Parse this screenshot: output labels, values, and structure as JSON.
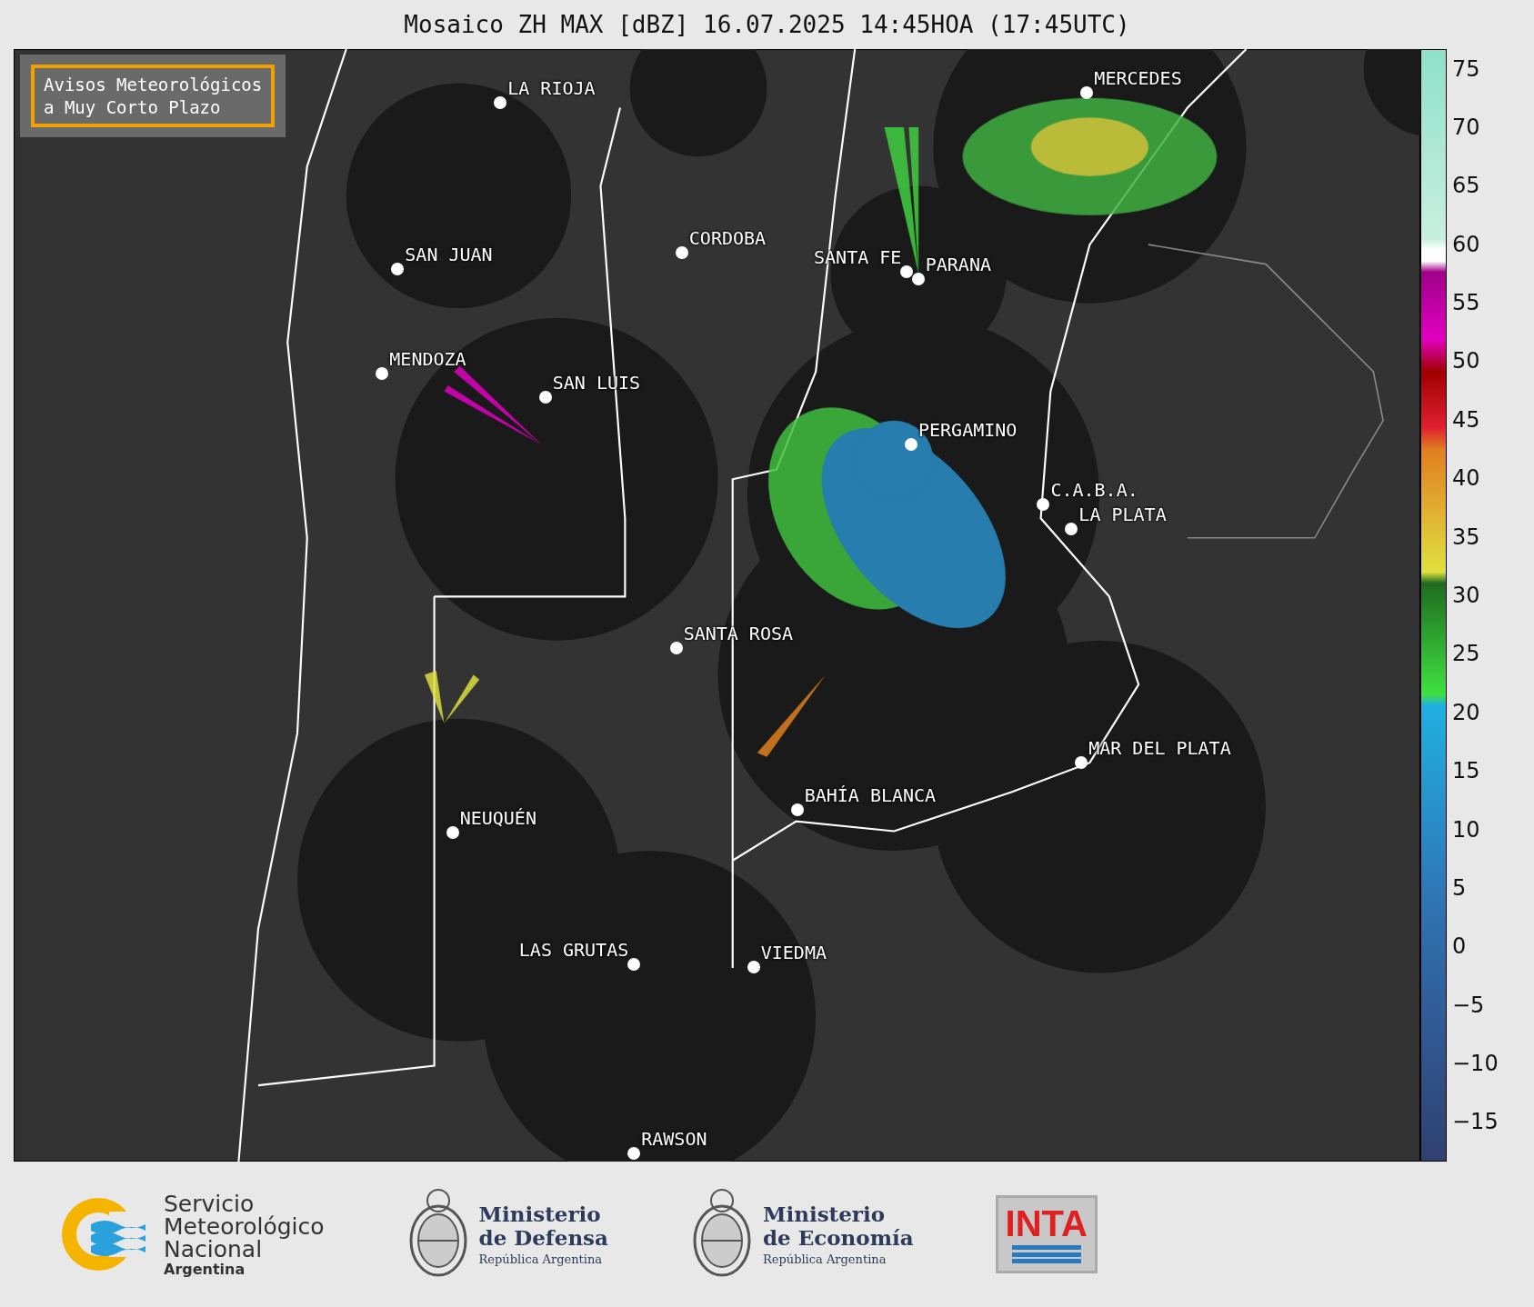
{
  "title": "Mosaico ZH MAX [dBZ] 16.07.2025 14:45HOA (17:45UTC)",
  "notice": {
    "lines": [
      "Avisos Meteorológicos",
      "a Muy Corto Plazo"
    ]
  },
  "cities": [
    {
      "name": "LA RIOJA"
    },
    {
      "name": "SAN JUAN"
    },
    {
      "name": "CORDOBA"
    },
    {
      "name": "SANTA FE"
    },
    {
      "name": "PARANA"
    },
    {
      "name": "MERCEDES"
    },
    {
      "name": "MENDOZA"
    },
    {
      "name": "SAN LUIS"
    },
    {
      "name": "PERGAMINO"
    },
    {
      "name": "C.A.B.A."
    },
    {
      "name": "LA PLATA"
    },
    {
      "name": "SANTA ROSA"
    },
    {
      "name": "MAR DEL PLATA"
    },
    {
      "name": "BAHÍA BLANCA"
    },
    {
      "name": "NEUQUÉN"
    },
    {
      "name": "LAS GRUTAS"
    },
    {
      "name": "VIEDMA"
    },
    {
      "name": "RAWSON"
    }
  ],
  "colorbar_ticks": [
    "75",
    "70",
    "65",
    "60",
    "55",
    "50",
    "45",
    "40",
    "35",
    "30",
    "25",
    "20",
    "15",
    "10",
    "5",
    "0",
    "−5",
    "−10",
    "−15"
  ],
  "footer": {
    "smn": {
      "lines": [
        "Servicio",
        "Meteorológico",
        "Nacional"
      ],
      "country": "Argentina"
    },
    "defensa": {
      "lines": [
        "Ministerio",
        "de Defensa"
      ],
      "sub": "República Argentina"
    },
    "economia": {
      "lines": [
        "Ministerio",
        "de Economía"
      ],
      "sub": "República Argentina"
    },
    "inta": "INTA"
  }
}
